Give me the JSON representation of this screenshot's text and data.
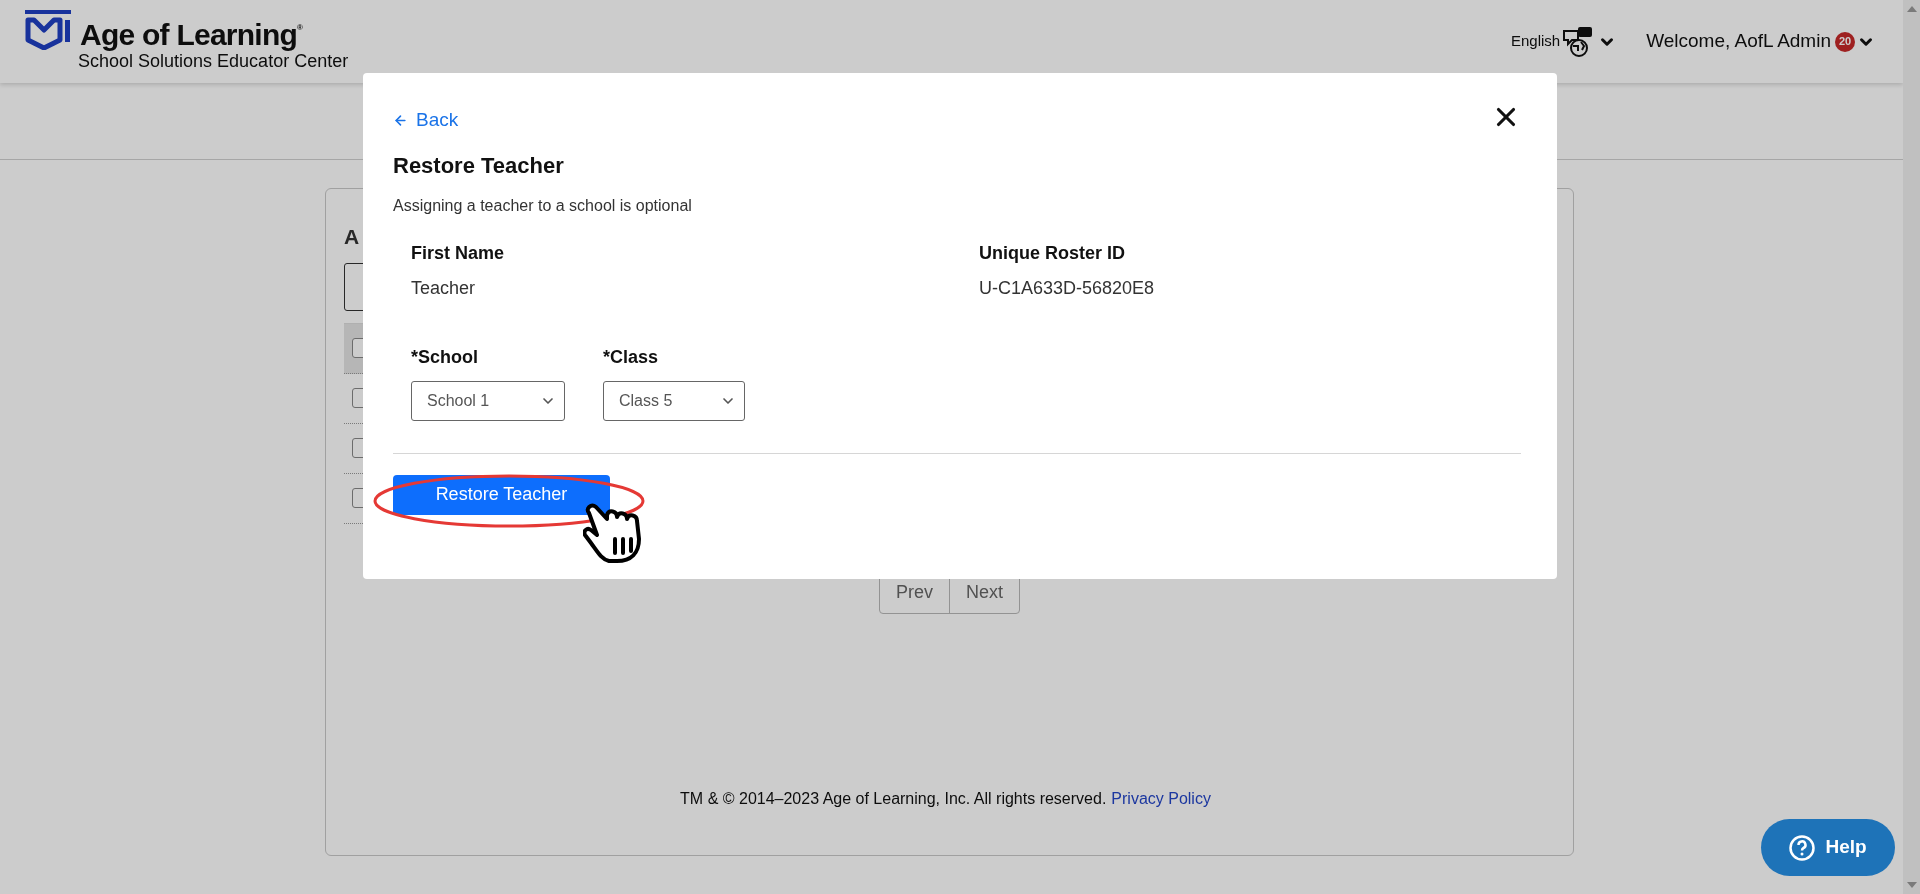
{
  "header": {
    "logo_title": "Age of Learning",
    "logo_mark": "®",
    "logo_subtitle": "School Solutions Educator Center",
    "language": "English",
    "welcome": "Welcome, AofL Admin",
    "notification_count": "20"
  },
  "background_card": {
    "title_fragment": "A",
    "rows": [
      {
        "checked": false
      },
      {
        "checked": false
      },
      {
        "checked": false
      },
      {
        "checked": false
      }
    ],
    "pagination": [
      "Prev",
      "Next"
    ]
  },
  "modal": {
    "back": "Back",
    "title": "Restore Teacher",
    "subtitle": "Assigning a teacher to a school is optional",
    "fields": [
      {
        "label": "First Name",
        "value": "Teacher"
      },
      {
        "label": "Unique Roster ID",
        "value": "U-C1A633D-56820E8"
      }
    ],
    "selects": [
      {
        "label": "*School",
        "value": "School 1"
      },
      {
        "label": "*Class",
        "value": "Class 5"
      }
    ],
    "primary_button": "Restore Teacher"
  },
  "footer": {
    "copyright": "TM & © 2014–2023 Age of Learning, Inc. All rights reserved.",
    "link": "Privacy Policy"
  },
  "help_button": "Help"
}
